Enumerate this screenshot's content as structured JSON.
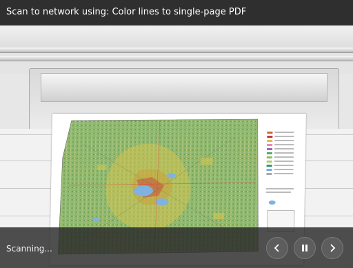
{
  "header": {
    "title": "Scan to network using: Color lines to single-page PDF"
  },
  "status": {
    "text": "Scanning..."
  },
  "controls": {
    "previous_icon": "chevron-left-icon",
    "pause_icon": "pause-icon",
    "next_icon": "chevron-right-icon"
  },
  "colors": {
    "bar": "#2f2f2f",
    "map_green": "#8ab36a",
    "map_urban": "#d1c14d",
    "lake": "#7fb2e0"
  }
}
